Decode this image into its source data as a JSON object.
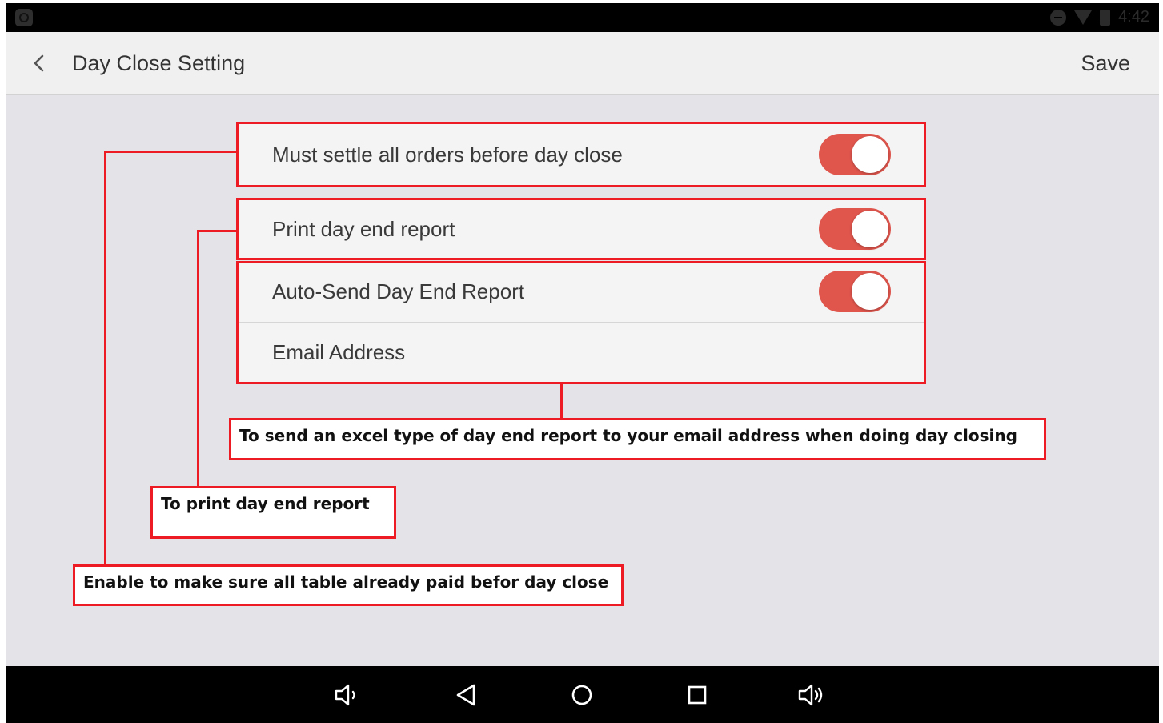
{
  "app": {
    "title": "Day Close Setting",
    "save_label": "Save",
    "accent_color": "#e0564d",
    "annotation_color": "#ed1c24"
  },
  "status_bar": {
    "time": "4:42",
    "icons": [
      "app-icon",
      "do-not-disturb-icon",
      "wifi-icon",
      "battery-icon"
    ]
  },
  "settings": [
    {
      "label": "Must settle all orders before day close",
      "control": "toggle",
      "enabled": true
    },
    {
      "label": "Print day end report",
      "control": "toggle",
      "enabled": true
    },
    {
      "label": "Auto-Send Day End Report",
      "control": "toggle",
      "enabled": true
    },
    {
      "label": "Email Address",
      "control": "text"
    }
  ],
  "callouts": {
    "email": "To send an excel type of day end report to your email address when doing day closing",
    "print": "To print day end report",
    "settle": "Enable to make sure all table already paid befor day close"
  },
  "nav_bar": {
    "icons": [
      "volume-down-icon",
      "back-icon",
      "home-icon",
      "recents-icon",
      "volume-up-icon"
    ]
  }
}
